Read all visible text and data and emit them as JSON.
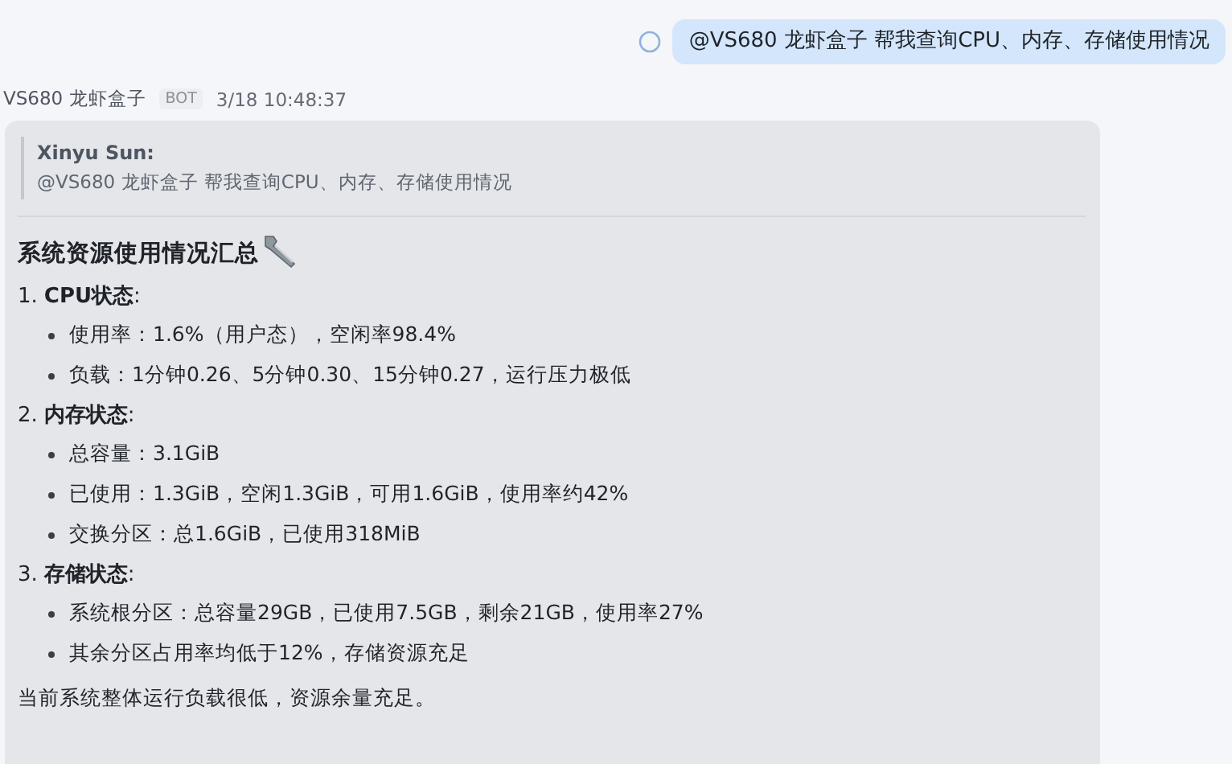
{
  "user_message": {
    "text": "@VS680 龙虾盒子 帮我查询CPU、内存、存储使用情况"
  },
  "bot_header": {
    "name": "VS680 龙虾盒子",
    "tag": "BOT",
    "time": "3/18 10:48:37"
  },
  "quote": {
    "author": "Xinyu Sun:",
    "text": "@VS680 龙虾盒子  帮我查询CPU、内存、存储使用情况"
  },
  "title": "系统资源使用情况汇总",
  "sections": [
    {
      "number": "1.",
      "heading": "CPU状态",
      "colon": ":",
      "bullets": [
        "使用率：1.6%（用户态），空闲率98.4%",
        "负载：1分钟0.26、5分钟0.30、15分钟0.27，运行压力极低"
      ]
    },
    {
      "number": "2.",
      "heading": "内存状态",
      "colon": ":",
      "bullets": [
        "总容量：3.1GiB",
        "已使用：1.3GiB，空闲1.3GiB，可用1.6GiB，使用率约42%",
        "交换分区：总1.6GiB，已使用318MiB"
      ]
    },
    {
      "number": "3.",
      "heading": "存储状态",
      "colon": ":",
      "bullets": [
        "系统根分区：总容量29GB，已使用7.5GB，剩余21GB，使用率27%",
        "其余分区占用率均低于12%，存储资源充足"
      ]
    }
  ],
  "summary": "当前系统整体运行负载很低，资源余量充足。"
}
